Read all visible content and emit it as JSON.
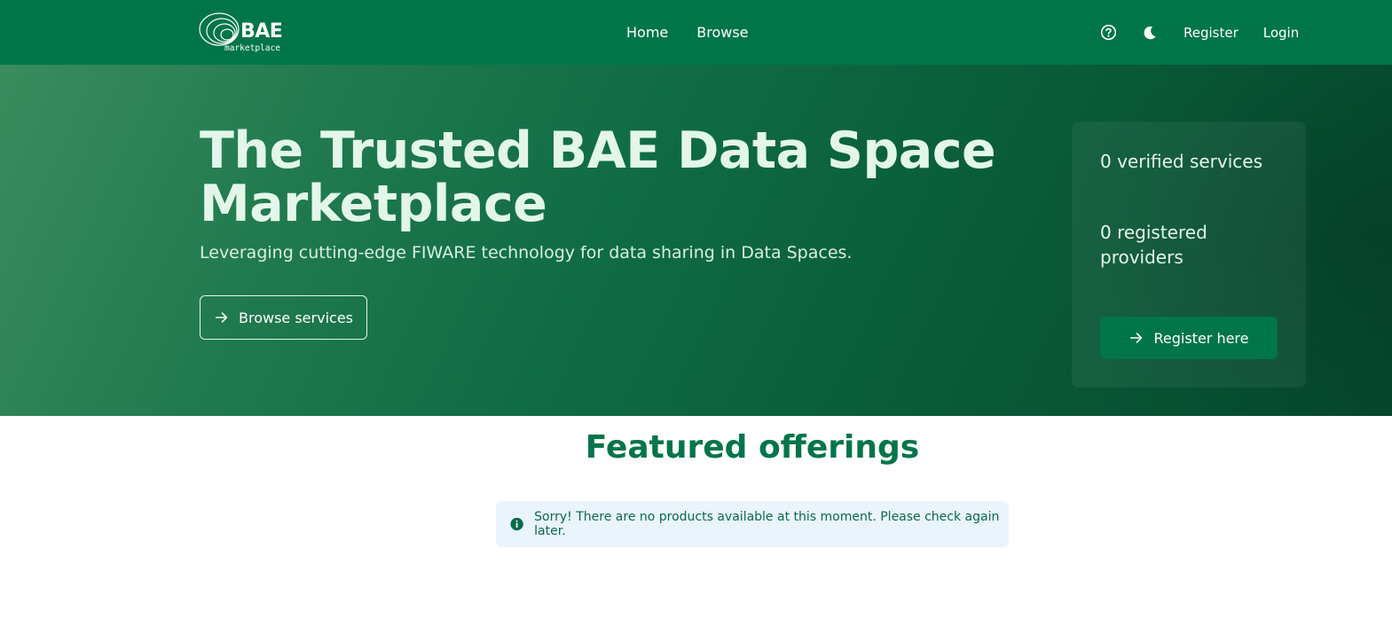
{
  "navbar": {
    "logo_text": "BAE",
    "logo_subtext": "marketplace",
    "links": [
      {
        "label": "Home"
      },
      {
        "label": "Browse"
      }
    ],
    "help_icon": "help-circle-icon",
    "theme_icon": "moon-icon",
    "register_label": "Register",
    "login_label": "Login"
  },
  "hero": {
    "title": "The Trusted BAE Data Space Marketplace",
    "subtitle": "Leveraging cutting-edge FIWARE technology for data sharing in Data Spaces.",
    "browse_button_label": "Browse services",
    "browse_button_icon": "arrow-right-icon"
  },
  "stats": {
    "verified_services": "0 verified services",
    "registered_providers": "0 registered providers",
    "register_button_label": "Register here",
    "register_button_icon": "arrow-right-icon"
  },
  "featured": {
    "title": "Featured offerings",
    "empty_message": "Sorry! There are no products available at this moment. Please check again later.",
    "info_icon": "info-circle-icon"
  },
  "colors": {
    "brand_green": "#00754a",
    "hero_text": "#e3f6ea",
    "alert_background": "#e9f4fe"
  }
}
